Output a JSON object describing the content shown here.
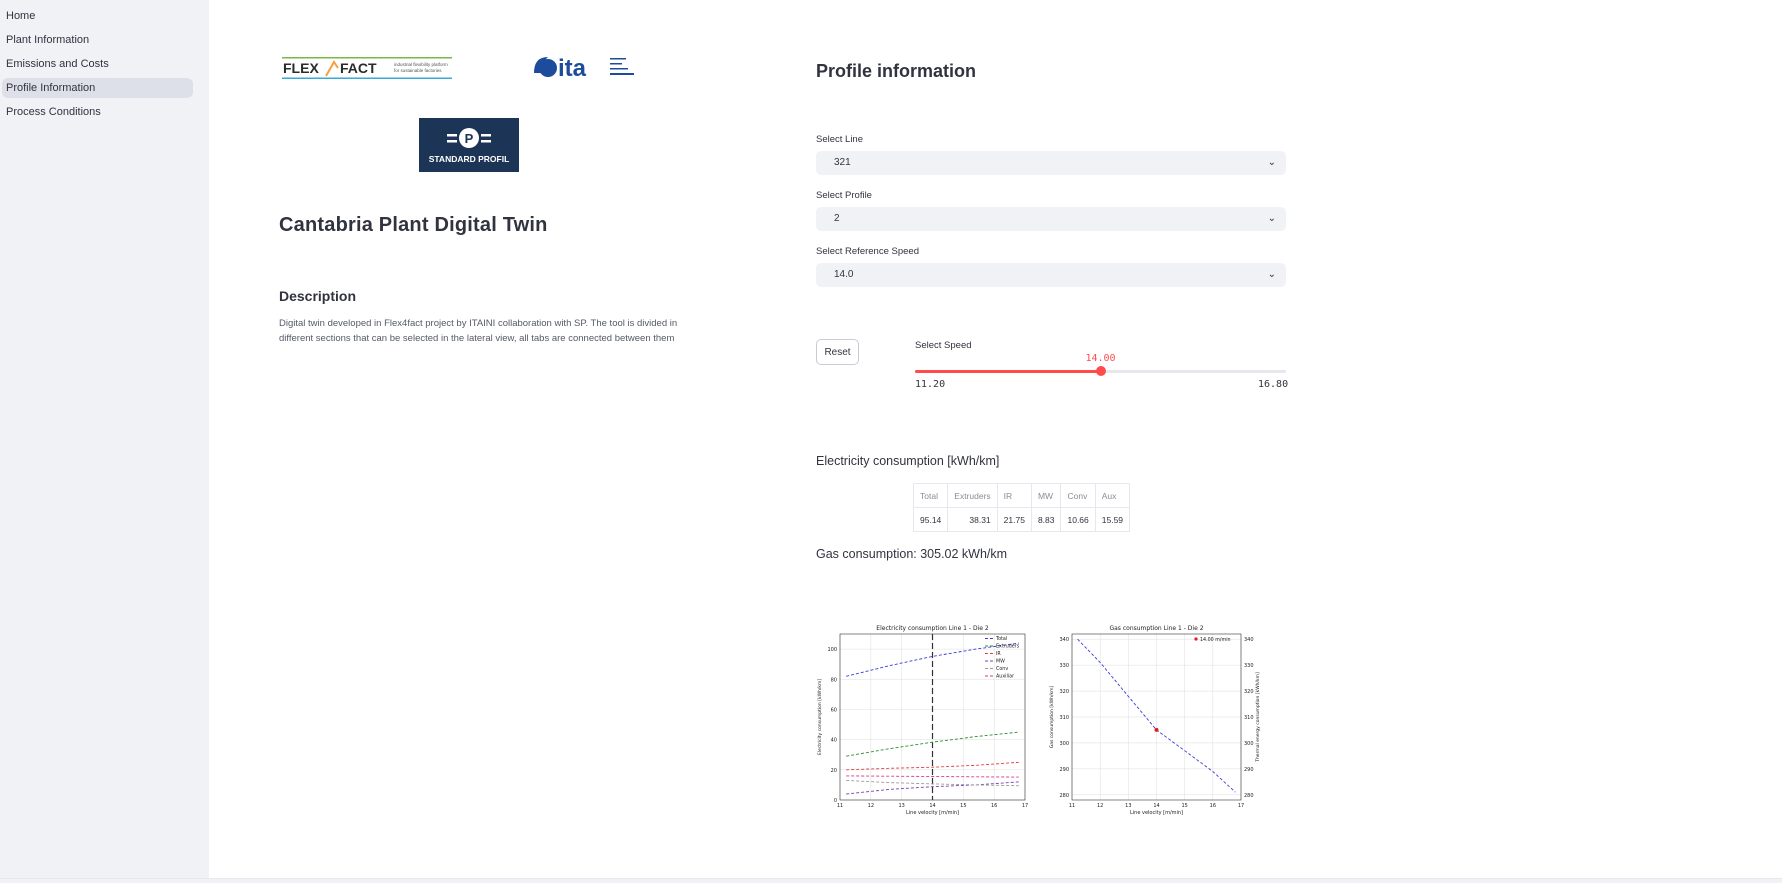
{
  "sidebar": {
    "items": [
      {
        "label": "Home"
      },
      {
        "label": "Plant Information"
      },
      {
        "label": "Emissions and Costs"
      },
      {
        "label": "Profile Information",
        "active": true
      },
      {
        "label": "Process Conditions"
      }
    ]
  },
  "logos": {
    "flex_fact": "FLEX",
    "flex_fact2": "FACT",
    "flex_tag1": "industrial flexibility platform",
    "flex_tag2": "for sustainable factories",
    "ita": "ita",
    "standard_profil": "STANDARD PROFIL"
  },
  "left": {
    "title": "Cantabria Plant Digital Twin",
    "description_title": "Description",
    "description": "Digital twin developed in Flex4fact project by ITAINI collaboration with SP. The tool is divided in different sections that can be selected in the lateral view, all tabs are connected between them"
  },
  "profile": {
    "title": "Profile information",
    "line_label": "Select Line",
    "line_value": "321",
    "profile_label": "Select Profile",
    "profile_value": "2",
    "ref_speed_label": "Select Reference Speed",
    "ref_speed_value": "14.0",
    "reset_label": "Reset",
    "speed_label": "Select Speed",
    "speed_value": "14.00",
    "speed_min": "11.20",
    "speed_max": "16.80",
    "speed_fraction": 0.5
  },
  "electricity": {
    "title": "Electricity consumption [kWh/km]",
    "headers": [
      "Total",
      "Extruders",
      "IR",
      "MW",
      "Conv",
      "Aux"
    ],
    "values": [
      "95.14",
      "38.31",
      "21.75",
      "8.83",
      "10.66",
      "15.59"
    ]
  },
  "gas": {
    "text": "Gas consumption: 305.02 kWh/km"
  },
  "colors": {
    "accent": "#ff4b4b",
    "sidebar_bg": "#f0f2f6"
  },
  "chart_data": [
    {
      "type": "line",
      "title": "Electricity consumption  Line 1 - Die 2",
      "xlabel": "Line velocity [m/min]",
      "ylabel": "Electricity consumption [kWh/km]",
      "xlim": [
        11,
        17
      ],
      "ylim": [
        0,
        110
      ],
      "xticks": [
        11,
        12,
        13,
        14,
        15,
        16,
        17
      ],
      "yticks": [
        0,
        20,
        40,
        60,
        80,
        100
      ],
      "grid": true,
      "legend": "top-right",
      "vline": 14,
      "x": [
        11.2,
        12.6,
        14.0,
        15.4,
        16.8
      ],
      "series": [
        {
          "name": "Total",
          "color": "#3b3bd6",
          "values": [
            82,
            89,
            95.14,
            100,
            104
          ]
        },
        {
          "name": "Extruders",
          "color": "#2e8b2e",
          "values": [
            29,
            34,
            38.31,
            42,
            45
          ]
        },
        {
          "name": "IR",
          "color": "#e04040",
          "values": [
            20,
            21,
            21.75,
            23,
            25
          ]
        },
        {
          "name": "MW",
          "color": "#7a3db8",
          "values": [
            4,
            7,
            8.83,
            10,
            12
          ]
        },
        {
          "name": "Conv",
          "color": "#999999",
          "values": [
            13,
            11.5,
            10.66,
            10,
            9.5
          ]
        },
        {
          "name": "Auxiliar",
          "color": "#d83a8a",
          "values": [
            16,
            15.8,
            15.59,
            15.4,
            15.2
          ]
        }
      ]
    },
    {
      "type": "line",
      "title": "Gas consumption  Line 1 - Die 2",
      "xlabel": "Line velocity [m/min]",
      "ylabel": "Gas consumption [kWh/km]",
      "ylabel2": "Thermal energy consumption [kWh/km]",
      "xlim": [
        11,
        17
      ],
      "ylim": [
        278,
        342
      ],
      "xticks": [
        11,
        12,
        13,
        14,
        15,
        16,
        17
      ],
      "yticks": [
        280,
        290,
        300,
        310,
        320,
        330,
        340
      ],
      "grid": true,
      "legend": "top-right",
      "x": [
        11.2,
        12.0,
        13.0,
        14.0,
        15.0,
        16.0,
        16.8
      ],
      "series": [
        {
          "name": "",
          "color": "#3b3bd6",
          "values": [
            340,
            331,
            318,
            305.02,
            297,
            289,
            281
          ]
        }
      ],
      "marker": {
        "name": "14.00 m/min",
        "x": 14.0,
        "y": 305.02,
        "color": "#e02020"
      }
    }
  ]
}
